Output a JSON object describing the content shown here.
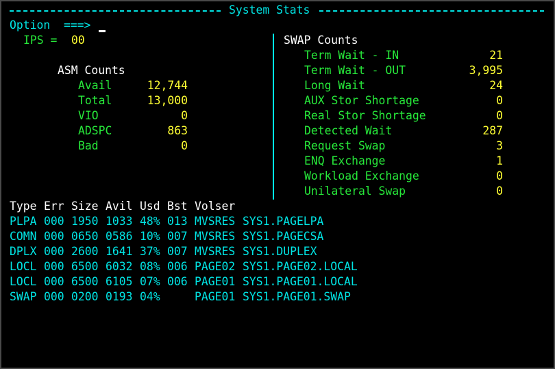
{
  "header": {
    "title": "System Stats"
  },
  "command": {
    "prompt": "Option  ===>",
    "value": ""
  },
  "ips": {
    "label": "IPS =",
    "value": "00"
  },
  "asm": {
    "title": "ASM Counts",
    "rows": [
      {
        "label": "Avail",
        "value": "12,744"
      },
      {
        "label": "Total",
        "value": "13,000"
      },
      {
        "label": "VIO",
        "value": "0"
      },
      {
        "label": "ADSPC",
        "value": "863"
      },
      {
        "label": "Bad",
        "value": "0"
      }
    ]
  },
  "swap": {
    "title": "SWAP Counts",
    "rows": [
      {
        "label": "Term Wait - IN",
        "value": "21"
      },
      {
        "label": "Term Wait - OUT",
        "value": "3,995"
      },
      {
        "label": "Long Wait",
        "value": "24"
      },
      {
        "label": "AUX Stor Shortage",
        "value": "0"
      },
      {
        "label": "Real Stor Shortage",
        "value": "0"
      },
      {
        "label": "Detected Wait",
        "value": "287"
      },
      {
        "label": "Request Swap",
        "value": "3"
      },
      {
        "label": "ENQ Exchange",
        "value": "1"
      },
      {
        "label": "Workload Exchange",
        "value": "0"
      },
      {
        "label": "Unilateral Swap",
        "value": "0"
      }
    ]
  },
  "table": {
    "headers": [
      "Type",
      "Err",
      "Size",
      "Avil",
      "Usd",
      "Bst",
      "Volser"
    ],
    "rows": [
      [
        "PLPA",
        "000",
        "1950",
        "1033",
        "48%",
        "013",
        "MVSRES",
        "SYS1.PAGELPA"
      ],
      [
        "COMN",
        "000",
        "0650",
        "0586",
        "10%",
        "007",
        "MVSRES",
        "SYS1.PAGECSA"
      ],
      [
        "DPLX",
        "000",
        "2600",
        "1641",
        "37%",
        "007",
        "MVSRES",
        "SYS1.DUPLEX"
      ],
      [
        "LOCL",
        "000",
        "6500",
        "6032",
        "08%",
        "006",
        "PAGE02",
        "SYS1.PAGE02.LOCAL"
      ],
      [
        "LOCL",
        "000",
        "6500",
        "6105",
        "07%",
        "006",
        "PAGE01",
        "SYS1.PAGE01.LOCAL"
      ],
      [
        "SWAP",
        "000",
        "0200",
        "0193",
        "04%",
        "",
        "PAGE01",
        "SYS1.PAGE01.SWAP"
      ]
    ]
  },
  "colors": {
    "cyan": "#00e5e5",
    "green": "#27e83a",
    "yellow": "#ffff33",
    "white": "#ffffff",
    "background": "#000000"
  }
}
